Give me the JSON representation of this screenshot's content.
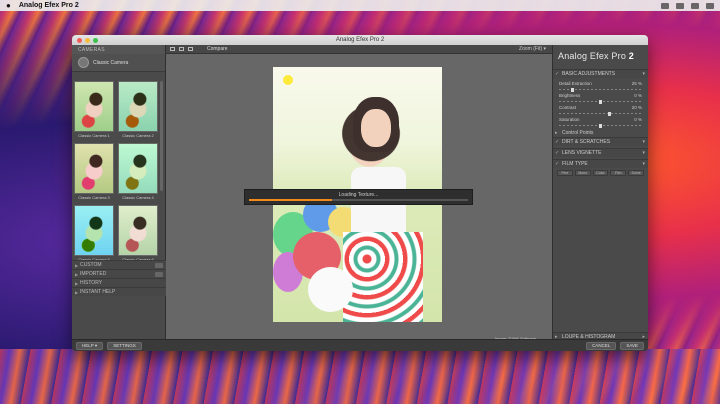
{
  "menubar": {
    "app_name": "Analog Efex Pro 2",
    "apple": ""
  },
  "window": {
    "title": "Analog Efex Pro 2"
  },
  "left_panel": {
    "header": "CAMERAS",
    "selected_camera": "Classic Camera",
    "thumbnails": [
      {
        "caption": "Classic Camera 1"
      },
      {
        "caption": "Classic Camera 2"
      },
      {
        "caption": "Classic Camera 3"
      },
      {
        "caption": "Classic Camera 4"
      },
      {
        "caption": "Classic Camera 5"
      },
      {
        "caption": "Classic Camera 6"
      }
    ],
    "categories": [
      "CUSTOM",
      "IMPORTED",
      "HISTORY",
      "INSTANT HELP"
    ]
  },
  "toolbar": {
    "compare": "Compare",
    "zoom": "Zoom (Fit) ▾"
  },
  "canvas": {
    "loading_text": "Loading Texture...",
    "loading_progress": 0.38,
    "caption1": "Image: © NIK Software",
    "caption2": "Analog Efex Pro Sample"
  },
  "right_panel": {
    "title_a": "Analog Efex Pro",
    "title_b": "2",
    "sections": {
      "basic": "BASIC ADJUSTMENTS",
      "dirt": "DIRT & SCRATCHES",
      "lens": "LENS VIGNETTE",
      "film": "FILM TYPE",
      "loupe": "LOUPE & HISTOGRAM"
    },
    "sliders": [
      {
        "label": "Detail Extraction",
        "value": "25 %"
      },
      {
        "label": "Brightness",
        "value": "0 %"
      },
      {
        "label": "Contrast",
        "value": "20 %"
      },
      {
        "label": "Saturation",
        "value": "0 %"
      }
    ],
    "control_points": "Control Points",
    "film_options": [
      "Fine",
      "Mono",
      "Color",
      "Film",
      "Some"
    ]
  },
  "bottom": {
    "help": "HELP ▾",
    "settings": "SETTINGS",
    "cancel": "CANCEL",
    "save": "SAVE"
  }
}
